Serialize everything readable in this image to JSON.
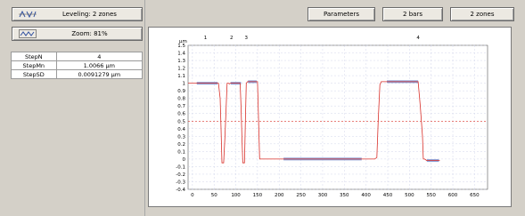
{
  "left_panel": {
    "leveling_label": "Leveling: 2 zones",
    "zoom_label": "Zoom: 81%",
    "stats": [
      {
        "name": "StepN",
        "value": "4"
      },
      {
        "name": "StepMn",
        "value": "1.0066 µm"
      },
      {
        "name": "StepSD",
        "value": "0.0091279 µm"
      }
    ]
  },
  "toolbar": {
    "parameters_label": "Parameters",
    "bars_label": "2 bars",
    "zones_label": "2 zones"
  },
  "chart_data": {
    "type": "line",
    "y_unit_label": "µm",
    "markers": [
      "1",
      "2",
      "3",
      "4"
    ],
    "xlim": [
      -10,
      680
    ],
    "ylim": [
      -0.4,
      1.5
    ],
    "xticks": [
      0,
      50,
      100,
      150,
      200,
      250,
      300,
      350,
      400,
      450,
      500,
      550,
      600,
      650
    ],
    "yticks": [
      "1.5",
      "1.4",
      "1.3",
      "1.2",
      "1.1",
      "1",
      "0.9",
      "0.8",
      "0.7",
      "0.6",
      "0.5",
      "0.4",
      "0.3",
      "0.2",
      "0.1",
      "0",
      "-0.1",
      "-0.2",
      "-0.3",
      "-0.4"
    ],
    "reference_line_y": 0.5,
    "series": [
      {
        "x": [
          -10,
          60,
          64,
          66,
          68,
          72,
          75,
          80,
          83,
          85,
          87,
          90,
          110,
          112,
          114,
          116,
          120,
          122,
          124,
          127,
          130,
          150,
          155,
          160,
          350,
          420,
          425,
          428,
          432,
          435,
          440,
          520,
          525,
          530,
          532,
          535,
          540,
          570
        ],
        "y": [
          1.0,
          1.0,
          0.8,
          0.4,
          -0.05,
          -0.05,
          0.3,
          1.0,
          1.0,
          0.99,
          1.0,
          1.0,
          1.0,
          0.7,
          0.3,
          -0.05,
          -0.05,
          0.5,
          1.0,
          1.02,
          1.02,
          1.02,
          0.0,
          0.0,
          0.0,
          0.0,
          0.02,
          0.5,
          0.98,
          1.02,
          1.02,
          1.02,
          0.7,
          0.3,
          0.0,
          0.0,
          -0.02,
          -0.02
        ]
      }
    ],
    "zones": [
      {
        "x": [
          10,
          58
        ],
        "y": 1.0
      },
      {
        "x": [
          88,
          112
        ],
        "y": 1.0
      },
      {
        "x": [
          128,
          148
        ],
        "y": 1.02
      },
      {
        "x": [
          210,
          390
        ],
        "y": 0.0
      },
      {
        "x": [
          448,
          520
        ],
        "y": 1.02
      },
      {
        "x": [
          540,
          568
        ],
        "y": -0.02
      }
    ],
    "colors": {
      "trace": "#d9312b",
      "zone": "#8a9fd6",
      "grid": "#c8cde6"
    }
  }
}
